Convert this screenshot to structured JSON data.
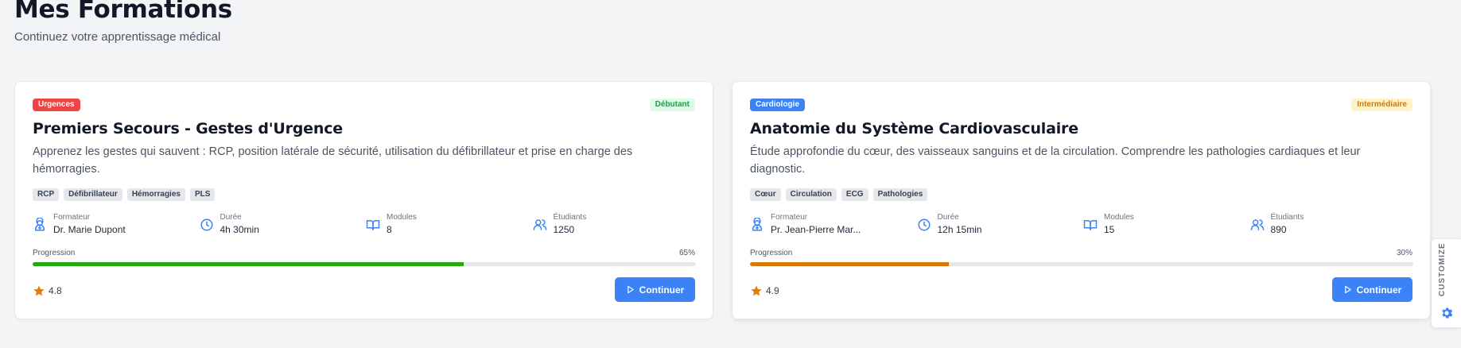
{
  "header": {
    "title": "Mes Formations",
    "subtitle": "Continuez votre apprentissage médical"
  },
  "labels": {
    "trainer": "Formateur",
    "duration": "Durée",
    "modules": "Modules",
    "students": "Étudiants",
    "progress": "Progression",
    "continue": "Continuer",
    "customize": "CUSTOMIZE"
  },
  "colors": {
    "primary": "#3b82f6",
    "urgences": "#ef4444",
    "cardiologie": "#3b82f6",
    "debutant_bg": "#dcfce7",
    "debutant_fg": "#16a34a",
    "intermediaire_bg": "#fef3c7",
    "intermediaire_fg": "#d97706",
    "progress_green": "#22a90c",
    "progress_orange": "#d97706",
    "star": "#e07b12"
  },
  "courses": [
    {
      "category": "Urgences",
      "category_color": "#ef4444",
      "level": "Débutant",
      "title": "Premiers Secours - Gestes d'Urgence",
      "description": "Apprenez les gestes qui sauvent : RCP, position latérale de sécurité, utilisation du défibrillateur et prise en charge des hémorragies.",
      "tags": [
        "RCP",
        "Défibrillateur",
        "Hémorragies",
        "PLS"
      ],
      "trainer": "Dr. Marie Dupont",
      "duration": "4h 30min",
      "modules": "8",
      "students": "1250",
      "progress_pct": "65%",
      "progress_value": 65,
      "rating": "4.8"
    },
    {
      "category": "Cardiologie",
      "category_color": "#3b82f6",
      "level": "Intermédiaire",
      "title": "Anatomie du Système Cardiovasculaire",
      "description": "Étude approfondie du cœur, des vaisseaux sanguins et de la circulation. Comprendre les pathologies cardiaques et leur diagnostic.",
      "tags": [
        "Cœur",
        "Circulation",
        "ECG",
        "Pathologies"
      ],
      "trainer": "Pr. Jean-Pierre Mar...",
      "duration": "12h 15min",
      "modules": "15",
      "students": "890",
      "progress_pct": "30%",
      "progress_value": 30,
      "rating": "4.9"
    }
  ]
}
